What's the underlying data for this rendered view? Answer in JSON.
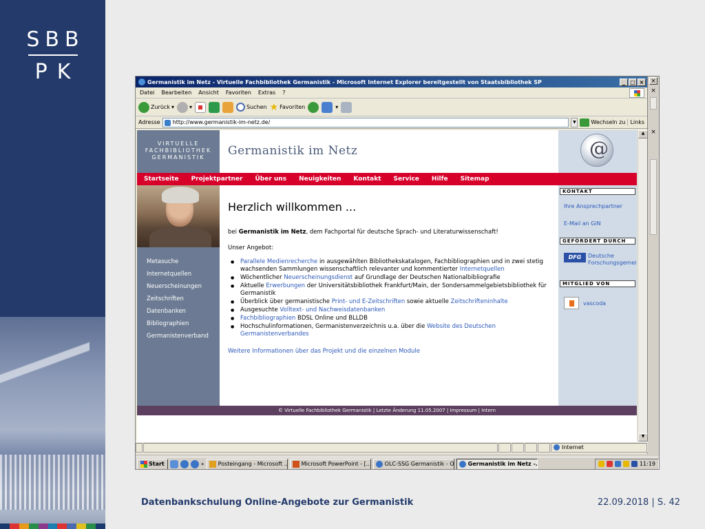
{
  "slide": {
    "logo_top": "SBB",
    "logo_bottom": "PK",
    "footer_left": "Datenbankschulung Online-Angebote zur Germanistik",
    "footer_right": "22.09.2018 | S. 42",
    "color_bar": [
      "#1a3a6e",
      "#d33",
      "#e89a1b",
      "#2a8d4a",
      "#8b3a8b",
      "#1c7fb0",
      "#d33",
      "#4a6ab0",
      "#e0c020",
      "#2a8d4a",
      "#1a3a6e"
    ]
  },
  "browser": {
    "title": "Germanistik im Netz - Virtuelle Fachbibliothek Germanistik - Microsoft Internet Explorer bereitgestellt von Staatsbibliothek SP",
    "menu": [
      "Datei",
      "Bearbeiten",
      "Ansicht",
      "Favoriten",
      "Extras",
      "?"
    ],
    "toolbar": {
      "back": "Zurück",
      "search": "Suchen",
      "favorites": "Favoriten"
    },
    "address_label": "Adresse",
    "address_value": "http://www.germanistik-im-netz.de/",
    "go_label": "Wechseln zu",
    "links_label": "Links",
    "status_zone": "Internet"
  },
  "site": {
    "logo_lines": [
      "VIRTUELLE",
      "FACHBIBLIOTHEK",
      "GERMANISTIK"
    ],
    "title": "Germanistik im Netz",
    "nav": [
      "Startseite",
      "Projektpartner",
      "Über uns",
      "Neuigkeiten",
      "Kontakt",
      "Service",
      "Hilfe",
      "Sitemap"
    ],
    "sidebar": [
      "Metasuche",
      "Internetquellen",
      "Neuerscheinungen",
      "Zeitschriften",
      "Datenbanken",
      "Bibliographien",
      "Germanistenverband"
    ],
    "welcome": "Herzlich willkommen ...",
    "intro_prefix": "bei ",
    "intro_bold": "Germanistik im Netz",
    "intro_suffix": ", dem Fachportal für deutsche Sprach- und Literaturwissenschaft!",
    "offers_head": "Unser Angebot:",
    "offers": [
      {
        "link": "Parallele Medienrecherche",
        "text": " in ausgewählten Bibliothekskatalogen, Fachbibliographien und in zwei stetig wachsenden Sammlungen wissenschaftlich relevanter und kommentierter ",
        "link2": "Internetquellen",
        "text2": ""
      },
      {
        "link": "",
        "pre": "Wöchentlicher ",
        "text": "",
        "link2": "Neuerscheinungsdienst",
        "text2": " auf Grundlage der Deutschen Nationalbibliografie"
      },
      {
        "link": "",
        "pre": "Aktuelle ",
        "text": "",
        "link2": "Erwerbungen",
        "text2": " der Universitätsbibliothek Frankfurt/Main, der Sondersammelgebietsbibliothek für Germanistik"
      },
      {
        "link": "",
        "pre": "Überblick über germanistische ",
        "text": "",
        "link2": "Print- und E-Zeitschriften",
        "text2": " sowie aktuelle ",
        "link3": "Zeitschrifteninhalte"
      },
      {
        "link": "",
        "pre": "Ausgesuchte ",
        "text": "",
        "link2": "Volltext- und Nachweisdatenbanken",
        "text2": ""
      },
      {
        "link": "Fachbibliographien",
        "text": " BDSL Online und BLLDB",
        "link2": "",
        "text2": ""
      },
      {
        "link": "",
        "pre": "Hochschulinformationen, Germanistenverzeichnis u.a. über die ",
        "text": "",
        "link2": "Website des Deutschen Germanistenverbandes",
        "text2": ""
      }
    ],
    "more_info": "Weitere Informationen über das Projekt und die einzelnen Module",
    "right": {
      "kontakt_title": "KONTAKT",
      "kontakt_links": [
        "Ihre Ansprechpartner",
        "E-Mail an GiN"
      ],
      "funded_title": "GEFÖRDERT DURCH",
      "dfg_logo": "DFG",
      "dfg_text": "Deutsche Forschungsgemeinschaft",
      "member_title": "MITGLIED VON",
      "vascoda": "vascoda"
    },
    "footer": "© Virtuelle Fachbibliothek Germanistik | Letzte Änderung 11.05.2007 | Impressum | Intern"
  },
  "taskbar": {
    "start": "Start",
    "tasks": [
      {
        "label": "Posteingang - Microsoft ...",
        "color": "#e0a020"
      },
      {
        "label": "Microsoft PowerPoint - [...",
        "color": "#d0501a"
      },
      {
        "label": "OLC-SSG Germanistik - O...",
        "color": "#3a74c7"
      },
      {
        "label": "Germanistik im Netz -...",
        "color": "#3a74c7"
      }
    ],
    "clock": "11:19"
  }
}
